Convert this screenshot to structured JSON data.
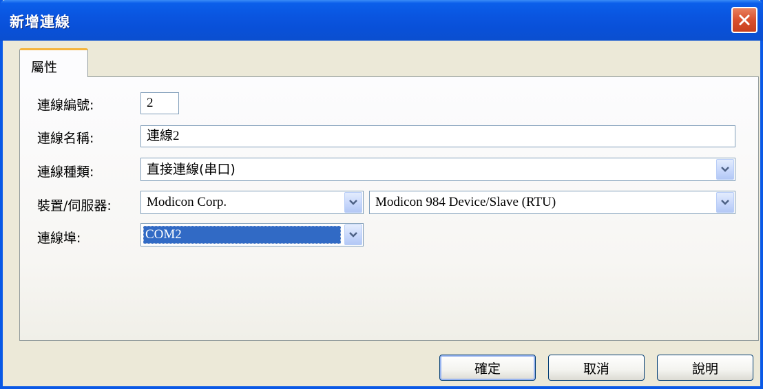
{
  "window": {
    "title": "新增連線"
  },
  "tabs": [
    {
      "label": "屬性"
    }
  ],
  "form": {
    "conn_no": {
      "label": "連線編號:",
      "value": "2"
    },
    "conn_name": {
      "label": "連線名稱:",
      "value": "連線2"
    },
    "conn_type": {
      "label": "連線種類:",
      "value": "直接連線(串口)"
    },
    "device": {
      "label": "裝置/伺服器:",
      "vendor": "Modicon Corp.",
      "model": "Modicon 984 Device/Slave (RTU)"
    },
    "port": {
      "label": "連線埠:",
      "value": "COM2"
    }
  },
  "buttons": {
    "ok": "確定",
    "cancel": "取消",
    "help": "說明"
  },
  "colors": {
    "titlebar": "#0a55e0",
    "selection": "#316ac5",
    "tab_accent": "#f5b43c"
  }
}
